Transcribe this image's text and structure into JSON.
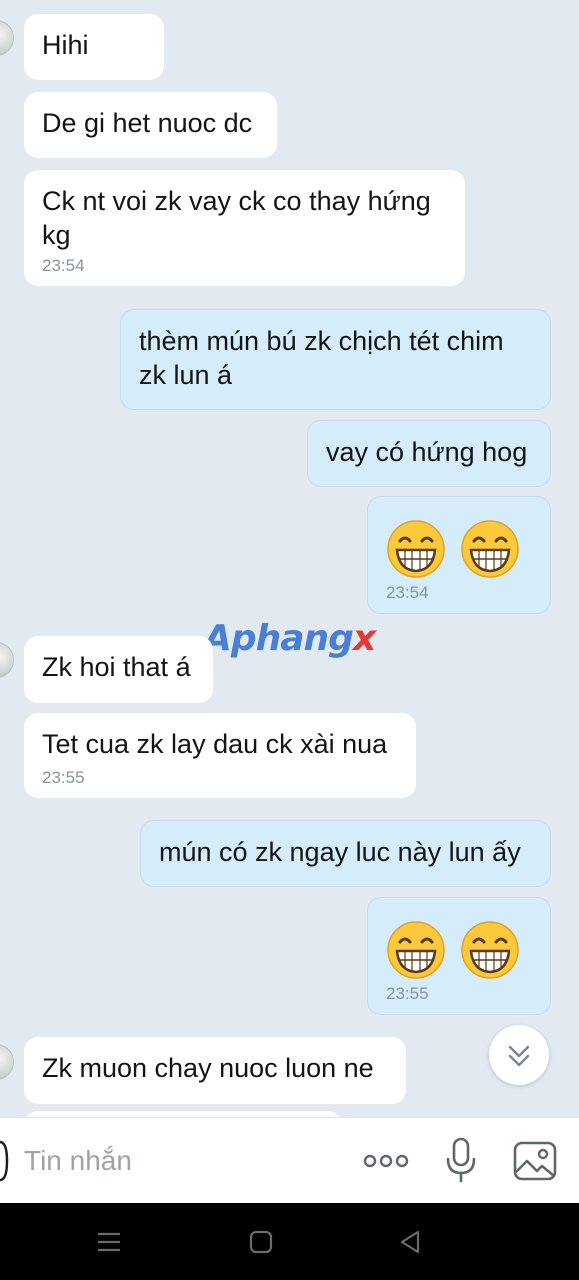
{
  "watermark": {
    "part1": "Aphang",
    "part2": "x"
  },
  "messages": [
    {
      "id": "m1",
      "side": "in",
      "text": "Hihi"
    },
    {
      "id": "m2",
      "side": "in",
      "text": "De gi het nuoc dc"
    },
    {
      "id": "m3",
      "side": "in",
      "line1": "Ck nt voi zk vay ck co thay hứng",
      "line2": "kg",
      "time": "23:54"
    },
    {
      "id": "m4",
      "side": "out",
      "line1": "thèm mún bú zk chịch tét chim",
      "line2": "zk lun á"
    },
    {
      "id": "m5",
      "side": "out",
      "text": "vay có hứng hog"
    },
    {
      "id": "m6",
      "side": "out",
      "emoji": "grinning-face-with-smiling-eyes",
      "count": 2,
      "time": "23:54"
    },
    {
      "id": "m7",
      "side": "in",
      "text": "Zk hoi that á"
    },
    {
      "id": "m8",
      "side": "in",
      "text": "Tet cua zk lay dau ck xài nua",
      "time": "23:55"
    },
    {
      "id": "m9",
      "side": "out",
      "text": "mún có zk ngay luc này lun ấy"
    },
    {
      "id": "m10",
      "side": "out",
      "emoji": "grinning-face-with-smiling-eyes",
      "count": 2,
      "time": "23:55"
    },
    {
      "id": "m11",
      "side": "in",
      "text": "Zk muon chay nuoc luon ne"
    }
  ],
  "scroll_button": {
    "icon": "double-chevron-down-icon"
  },
  "input_bar": {
    "placeholder": "Tin nhắn",
    "icons": [
      "more-dots-icon",
      "microphone-icon",
      "image-icon"
    ]
  },
  "nav_bar": {
    "icons": [
      "menu-icon",
      "home-square-icon",
      "back-triangle-icon"
    ]
  },
  "colors": {
    "background": "#e2e9f1",
    "incoming_bubble": "#ffffff",
    "outgoing_bubble": "#d5ecfb",
    "timestamp": "#8a929b",
    "placeholder": "#9ba3ab"
  }
}
